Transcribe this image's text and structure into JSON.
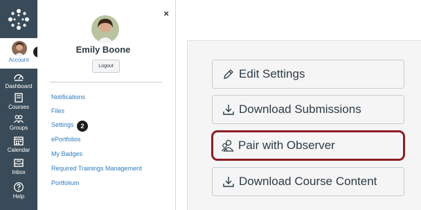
{
  "global_nav": {
    "account_label": "Account",
    "items": [
      {
        "label": "Dashboard",
        "icon": "dashboard-icon"
      },
      {
        "label": "Courses",
        "icon": "courses-icon"
      },
      {
        "label": "Groups",
        "icon": "groups-icon"
      },
      {
        "label": "Calendar",
        "icon": "calendar-icon"
      },
      {
        "label": "Inbox",
        "icon": "inbox-icon"
      },
      {
        "label": "Help",
        "icon": "help-icon"
      }
    ],
    "callout": "1"
  },
  "tray": {
    "user_name": "Emily Boone",
    "logout_label": "Logout",
    "close_glyph": "×",
    "links": [
      "Notifications",
      "Files",
      "Settings",
      "ePortfolios",
      "My Badges",
      "Required Trainings Management",
      "Portfolium"
    ],
    "callout": "2"
  },
  "sidebar": {
    "buttons": [
      {
        "label": "Edit Settings",
        "icon": "pencil-icon"
      },
      {
        "label": "Download Submissions",
        "icon": "download-icon"
      },
      {
        "label": "Pair with Observer",
        "icon": "pair-observer-icon"
      },
      {
        "label": "Download Course Content",
        "icon": "download-icon"
      }
    ],
    "highlight_color": "#8C1D22"
  },
  "colors": {
    "nav_bg": "#394B58",
    "link": "#2D7BC2"
  }
}
